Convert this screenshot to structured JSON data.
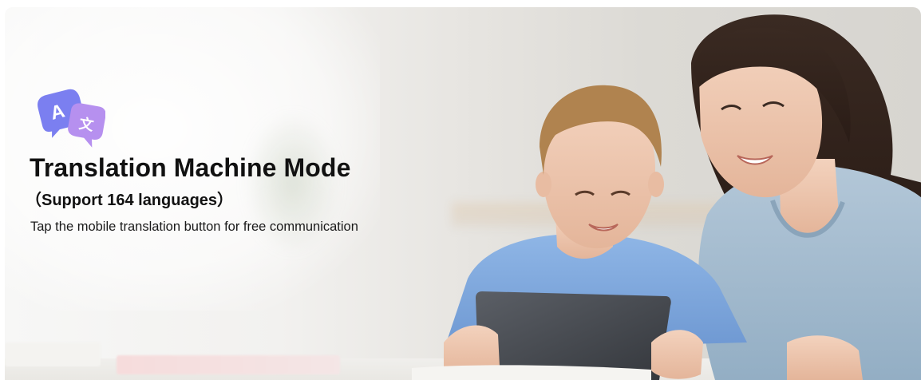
{
  "banner": {
    "title": "Translation Machine Mode",
    "subtitle": "（Support 164 languages）",
    "description": "Tap the mobile translation button for free communication",
    "icon": "translate-bubbles-icon",
    "colors": {
      "icon_back": "#7b7ff0",
      "icon_front": "#b690ef",
      "text": "#111111"
    }
  }
}
